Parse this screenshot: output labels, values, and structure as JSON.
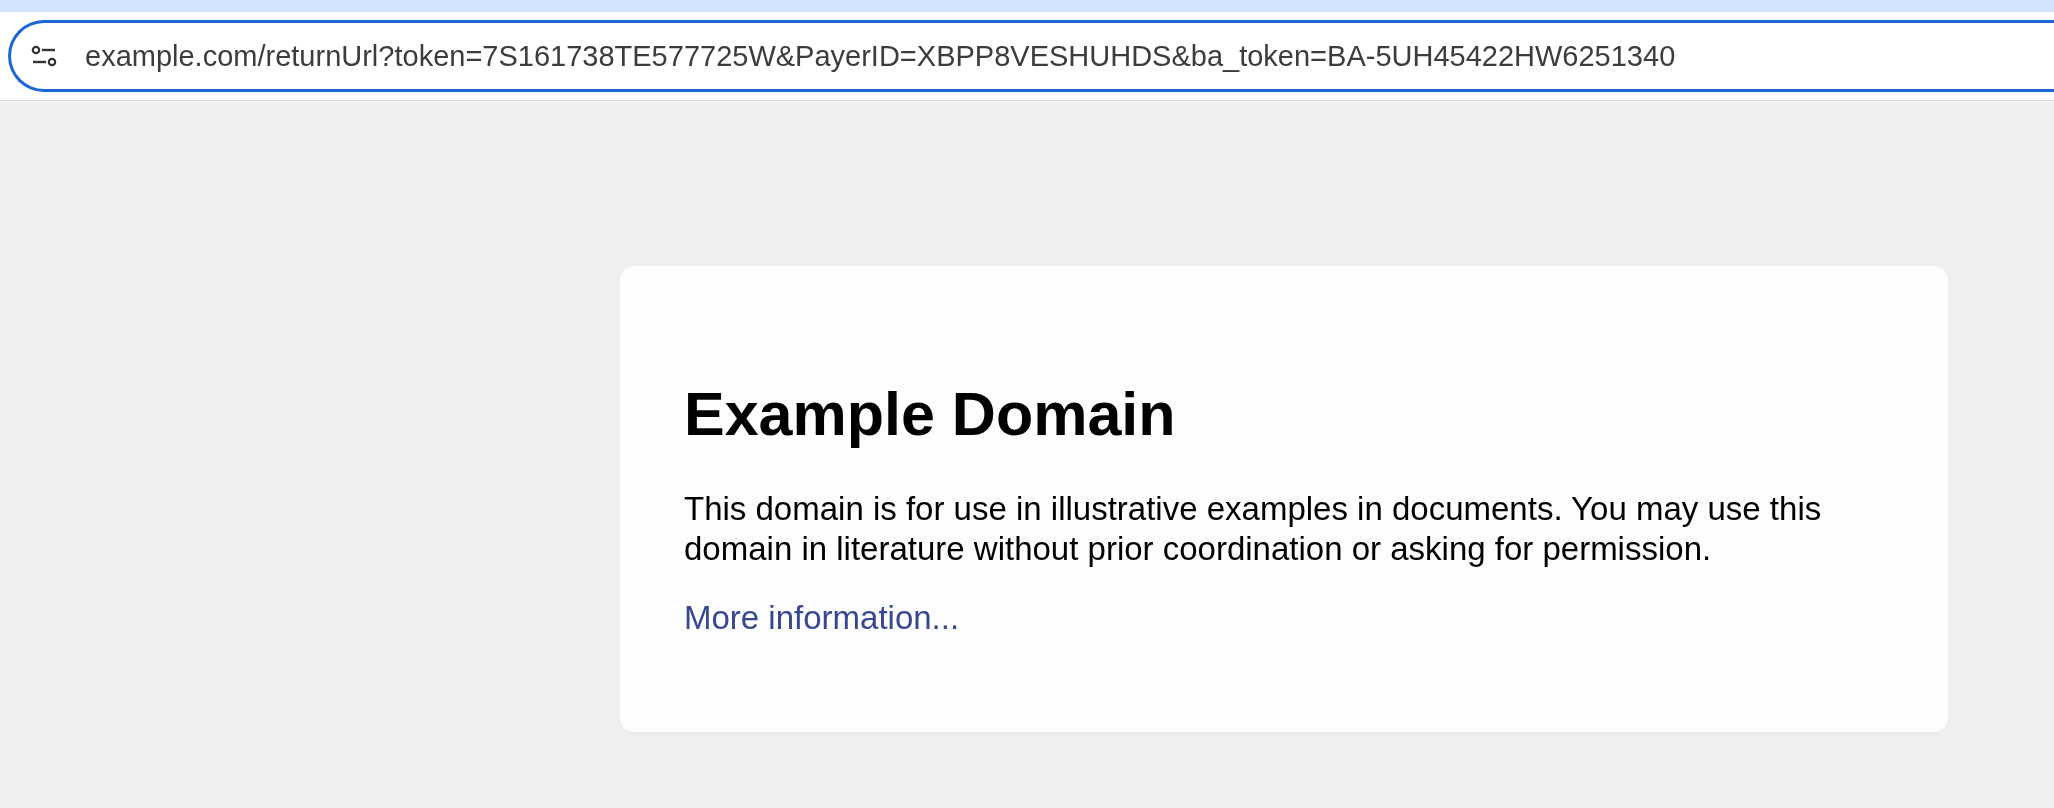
{
  "address_bar": {
    "url": "example.com/returnUrl?token=7S161738TE577725W&PayerID=XBPP8VESHUHDS&ba_token=BA-5UH45422HW6251340"
  },
  "page": {
    "heading": "Example Domain",
    "paragraph": "This domain is for use in illustrative examples in documents. You may use this domain in literature without prior coordination or asking for permission.",
    "link": "More information..."
  }
}
